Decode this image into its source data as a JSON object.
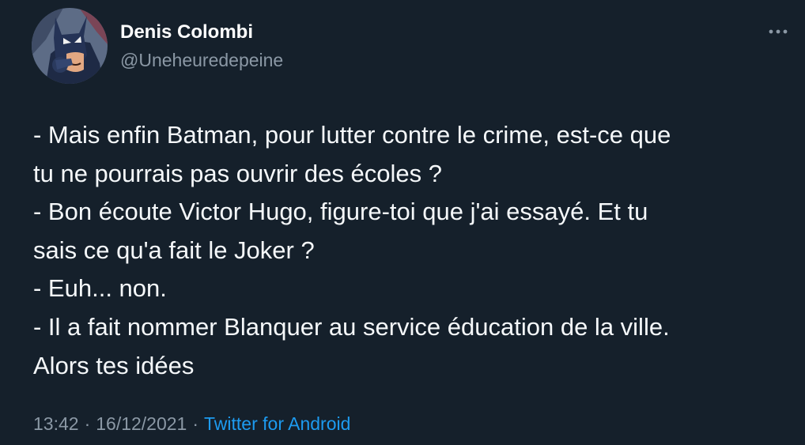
{
  "author": {
    "display_name": "Denis Colombi",
    "handle": "@Uneheuredepeine",
    "avatar_icon": "batman-avatar"
  },
  "menu": {
    "more_icon": "more-horizontal-icon"
  },
  "tweet": {
    "lines": [
      "- Mais enfin Batman, pour lutter contre le crime, est-ce que",
      "tu ne pourrais pas ouvrir des écoles ?",
      "- Bon écoute Victor Hugo, figure-toi que j'ai essayé. Et tu",
      "sais ce qu'a fait le Joker ?",
      "- Euh... non.",
      "- Il a fait nommer Blanquer au service éducation de la ville.",
      "Alors tes idées"
    ]
  },
  "meta": {
    "time": "13:42",
    "separator": "·",
    "date": "16/12/2021",
    "source": "Twitter for Android"
  },
  "colors": {
    "background": "#15202b",
    "text": "#f5f8fa",
    "muted": "#8b98a5",
    "link": "#1d9bf0"
  }
}
